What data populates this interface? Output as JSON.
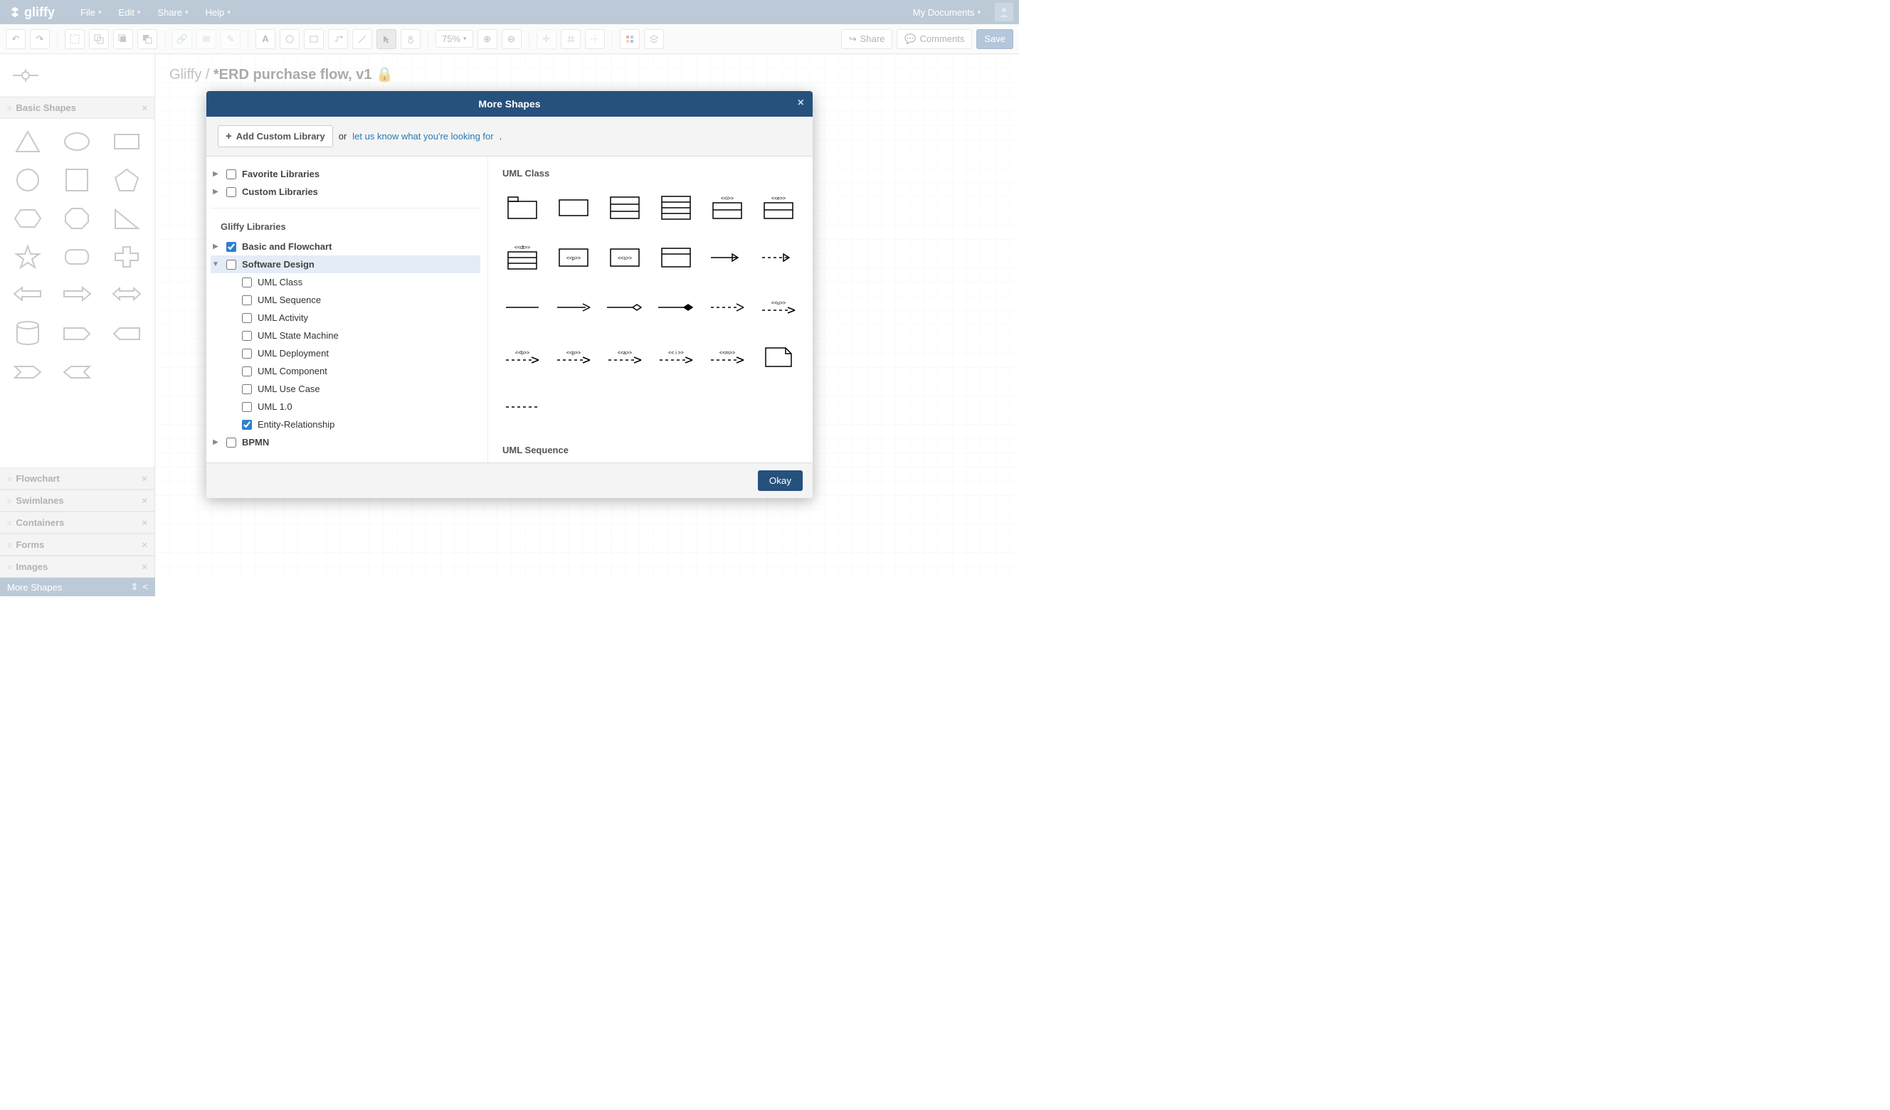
{
  "menubar": {
    "brand": "gliffy",
    "items": [
      "File",
      "Edit",
      "Share",
      "Help"
    ],
    "right": "My Documents"
  },
  "toolbar": {
    "zoom": "75%",
    "share": "Share",
    "comments": "Comments",
    "save": "Save"
  },
  "sidebar": {
    "panels": [
      "Basic Shapes",
      "Flowchart",
      "Swimlanes",
      "Containers",
      "Forms",
      "Images"
    ],
    "more": "More Shapes"
  },
  "canvas": {
    "breadcrumb_app": "Gliffy",
    "breadcrumb_doc": "*ERD purchase flow, v1"
  },
  "modal": {
    "title": "More Shapes",
    "add_custom": "Add Custom Library",
    "or": "or",
    "link_text": "let us know what you're looking for",
    "tree": {
      "favorite": "Favorite Libraries",
      "custom": "Custom Libraries",
      "gliffy_label": "Gliffy Libraries",
      "basic": "Basic and Flowchart",
      "software": "Software Design",
      "children": [
        "UML Class",
        "UML Sequence",
        "UML Activity",
        "UML State Machine",
        "UML Deployment",
        "UML Component",
        "UML Use Case",
        "UML 1.0",
        "Entity-Relationship"
      ],
      "bpmn": "BPMN"
    },
    "preview": {
      "title1": "UML Class",
      "title2": "UML Sequence",
      "labels": {
        "i": "<<i>>",
        "e": "<<e>>",
        "dt": "<<dt>>",
        "p": "<<p>>",
        "s": "<<s>>",
        "u": "<<u>>",
        "b": "<<b>>",
        "p2": "<<p>>",
        "a": "<<a>>",
        "i2": "<< i >>",
        "m": "<<m>>"
      }
    },
    "okay": "Okay"
  }
}
